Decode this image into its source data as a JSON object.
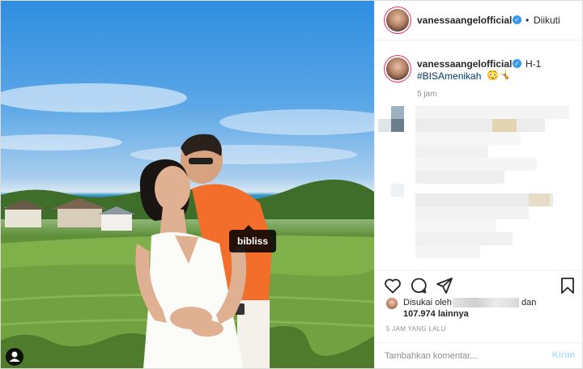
{
  "post": {
    "photo_tag": "bibliss"
  },
  "header": {
    "username": "vanessaangelofficial",
    "separator": "•",
    "follow_state": "Diikuti"
  },
  "caption": {
    "username": "vanessaangelofficial",
    "text": "H-1",
    "hashtag": "#BISAmenikah",
    "emojis": "😳🤸",
    "time": "5 jam"
  },
  "likes": {
    "prefix": "Disukai oleh",
    "conjunction": "dan",
    "count": "107.974",
    "suffix": "lainnya"
  },
  "post_date": "5 JAM YANG LALU",
  "comment": {
    "placeholder": "Tambahkan komentar...",
    "post_label": "Kirim"
  },
  "colors": {
    "accent": "#3897f0",
    "post_button_disabled": "#b2dffc",
    "secondary_text": "#8e8e8e"
  },
  "icons": [
    "user-tag-icon",
    "heart-icon",
    "comment-icon",
    "share-icon",
    "bookmark-icon",
    "verified-badge-icon"
  ]
}
